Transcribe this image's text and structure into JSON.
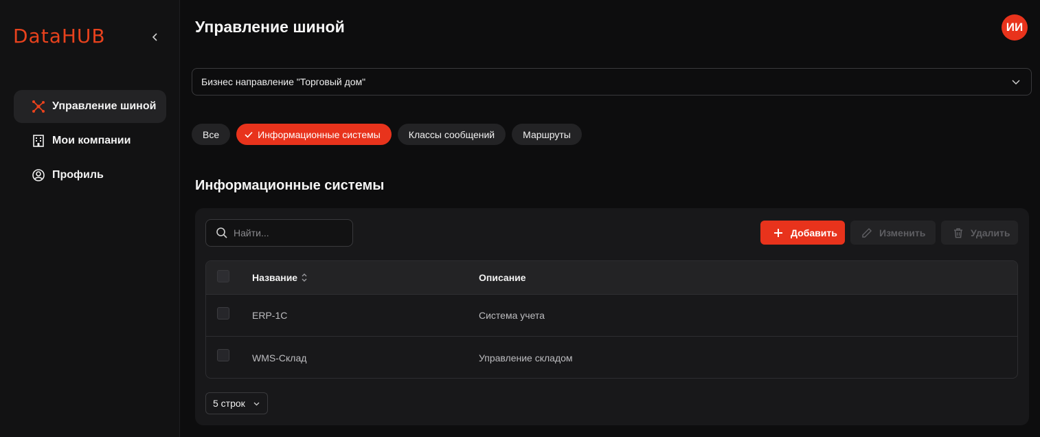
{
  "app": {
    "logo_part1": "Data",
    "logo_part2": "HUB"
  },
  "sidebar": {
    "items": [
      {
        "label": "Управление шиной",
        "icon": "network-icon",
        "active": true
      },
      {
        "label": "Мои компании",
        "icon": "building-icon",
        "active": false
      },
      {
        "label": "Профиль",
        "icon": "user-circle-icon",
        "active": false
      }
    ]
  },
  "header": {
    "title": "Управление шиной",
    "avatar_initials": "ИИ"
  },
  "business_select": {
    "value": "Бизнес направление \"Торговый дом\""
  },
  "filters": {
    "chips": [
      {
        "label": "Все",
        "active": false
      },
      {
        "label": "Информационные системы",
        "active": true
      },
      {
        "label": "Классы сообщений",
        "active": false
      },
      {
        "label": "Маршруты",
        "active": false
      }
    ]
  },
  "section": {
    "title": "Информационные системы"
  },
  "toolbar": {
    "search_placeholder": "Найти...",
    "add_label": "Добавить",
    "edit_label": "Изменить",
    "delete_label": "Удалить"
  },
  "table": {
    "columns": {
      "name": "Название",
      "description": "Описание"
    },
    "rows": [
      {
        "name": "ERP-1C",
        "description": "Система учета"
      },
      {
        "name": "WMS-Склад",
        "description": "Управление складом"
      }
    ]
  },
  "pagination": {
    "rows_per_page": "5 строк"
  },
  "colors": {
    "accent": "#e8331c",
    "background": "#0d0d0e",
    "panel": "#18181a"
  }
}
